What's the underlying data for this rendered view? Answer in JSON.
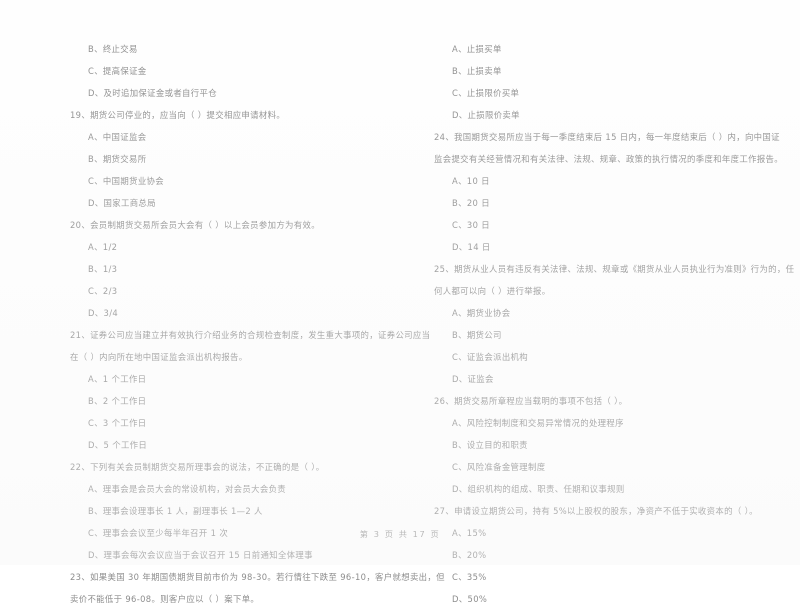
{
  "document": {
    "type": "exam-paper",
    "language": "zh-CN",
    "footer": "第 3 页 共 17 页",
    "text_color": "#8d8d8d",
    "background_color": "#fefefe"
  },
  "left_column": [
    {
      "kind": "option",
      "text": "B、终止交易"
    },
    {
      "kind": "option",
      "text": "C、提高保证金"
    },
    {
      "kind": "option",
      "text": "D、及时追加保证金或者自行平仓"
    },
    {
      "kind": "question",
      "text": "19、期货公司停业的，应当向（      ）提交相应申请材料。"
    },
    {
      "kind": "option",
      "text": "A、中国证监会"
    },
    {
      "kind": "option",
      "text": "B、期货交易所"
    },
    {
      "kind": "option",
      "text": "C、中国期货业协会"
    },
    {
      "kind": "option",
      "text": "D、国家工商总局"
    },
    {
      "kind": "question",
      "text": "20、会员制期货交易所会员大会有（      ）以上会员参加方为有效。"
    },
    {
      "kind": "option",
      "text": "A、1/2"
    },
    {
      "kind": "option",
      "text": "B、1/3"
    },
    {
      "kind": "option",
      "text": "C、2/3"
    },
    {
      "kind": "option",
      "text": "D、3/4"
    },
    {
      "kind": "question",
      "text": "21、证券公司应当建立并有效执行介绍业务的合规检查制度，发生重大事项的，证券公司应当"
    },
    {
      "kind": "continue",
      "text": "在（      ）内向所在地中国证监会派出机构报告。"
    },
    {
      "kind": "option",
      "text": "A、1 个工作日"
    },
    {
      "kind": "option",
      "text": "B、2 个工作日"
    },
    {
      "kind": "option",
      "text": "C、3 个工作日"
    },
    {
      "kind": "option",
      "text": "D、5 个工作日"
    },
    {
      "kind": "question",
      "text": "22、下列有关会员制期货交易所理事会的说法，不正确的是（      ）。"
    },
    {
      "kind": "option",
      "text": "A、理事会是会员大会的常设机构，对会员大会负责"
    },
    {
      "kind": "option",
      "text": "B、理事会设理事长 1 人，副理事长 1—2 人"
    },
    {
      "kind": "option",
      "text": "C、理事会会议至少每半年召开 1 次"
    },
    {
      "kind": "option",
      "text": "D、理事会每次会议应当于会议召开 15 日前通知全体理事"
    },
    {
      "kind": "question",
      "text": "23、如果美国 30 年期国债期货目前市价为 98-30。若行情往下跌至 96-10，客户就想卖出，但"
    },
    {
      "kind": "continue",
      "text": "卖价不能低于 96-08。则客户应以（      ）案下单。"
    }
  ],
  "right_column": [
    {
      "kind": "option",
      "text": "A、止损买单"
    },
    {
      "kind": "option",
      "text": "B、止损卖单"
    },
    {
      "kind": "option",
      "text": "C、止损限价买单"
    },
    {
      "kind": "option",
      "text": "D、止损限价卖单"
    },
    {
      "kind": "question",
      "text": "24、我国期货交易所应当于每一季度结束后 15 日内，每一年度结束后（      ）内，向中国证"
    },
    {
      "kind": "continue",
      "text": "监会提交有关经营情况和有关法律、法规、规章、政策的执行情况的季度和年度工作报告。"
    },
    {
      "kind": "option",
      "text": "A、10 日"
    },
    {
      "kind": "option",
      "text": "B、20 日"
    },
    {
      "kind": "option",
      "text": "C、30 日"
    },
    {
      "kind": "option",
      "text": "D、14 日"
    },
    {
      "kind": "question",
      "text": "25、期货从业人员有违反有关法律、法规、规章或《期货从业人员执业行为准则》行为的，任"
    },
    {
      "kind": "continue",
      "text": "何人都可以向（      ）进行举报。"
    },
    {
      "kind": "option",
      "text": "A、期货业协会"
    },
    {
      "kind": "option",
      "text": "B、期货公司"
    },
    {
      "kind": "option",
      "text": "C、证监会派出机构"
    },
    {
      "kind": "option",
      "text": "D、证监会"
    },
    {
      "kind": "question",
      "text": "26、期货交易所章程应当载明的事项不包括（      ）。"
    },
    {
      "kind": "option",
      "text": "A、风险控制制度和交易异常情况的处理程序"
    },
    {
      "kind": "option",
      "text": "B、设立目的和职责"
    },
    {
      "kind": "option",
      "text": "C、风险准备金管理制度"
    },
    {
      "kind": "option",
      "text": "D、组织机构的组成、职责、任期和议事规则"
    },
    {
      "kind": "question",
      "text": "27、申请设立期货公司，持有 5%以上股权的股东，净资产不低于实收资本的（      ）。"
    },
    {
      "kind": "option",
      "text": "A、15%"
    },
    {
      "kind": "option",
      "text": "B、20%"
    },
    {
      "kind": "option",
      "text": "C、35%"
    },
    {
      "kind": "option",
      "text": "D、50%"
    }
  ]
}
